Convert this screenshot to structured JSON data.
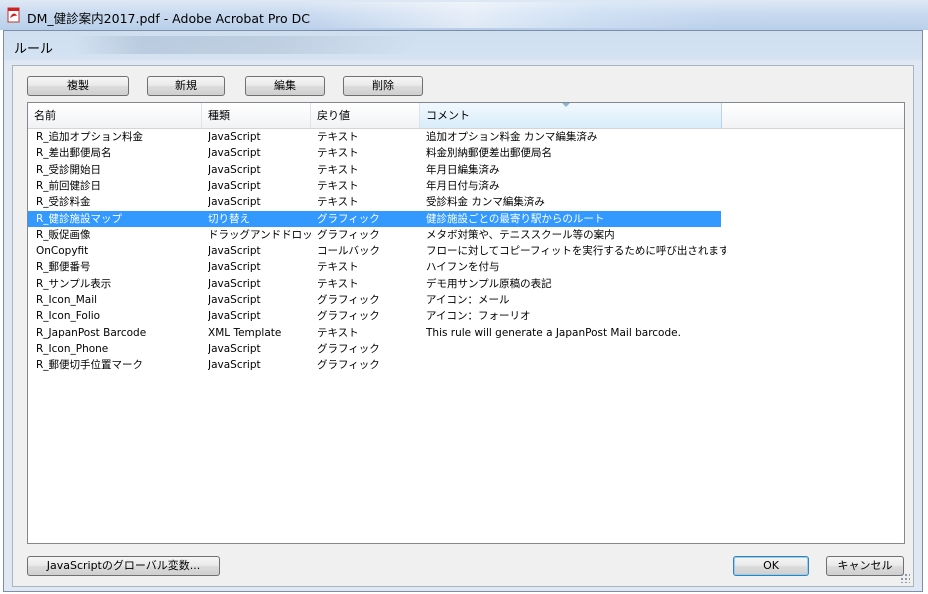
{
  "window": {
    "title": "DM_健診案内2017.pdf - Adobe Acrobat Pro DC",
    "app_icon": "acrobat-pdf-icon"
  },
  "dialog": {
    "title": "ルール"
  },
  "toolbar": {
    "duplicate_label": "複製",
    "new_label": "新規",
    "edit_label": "編集",
    "delete_label": "削除"
  },
  "list": {
    "columns": [
      "名前",
      "種類",
      "戻り値",
      "コメント"
    ],
    "rows": [
      {
        "name": "R_追加オプション料金",
        "type": "JavaScript",
        "ret": "テキスト",
        "comment": "追加オプション料金 カンマ編集済み",
        "selected": false
      },
      {
        "name": "R_差出郵便局名",
        "type": "JavaScript",
        "ret": "テキスト",
        "comment": "料金別納郵便差出郵便局名",
        "selected": false
      },
      {
        "name": "R_受診開始日",
        "type": "JavaScript",
        "ret": "テキスト",
        "comment": "年月日編集済み",
        "selected": false
      },
      {
        "name": "R_前回健診日",
        "type": "JavaScript",
        "ret": "テキスト",
        "comment": "年月日付与済み",
        "selected": false
      },
      {
        "name": "R_受診料金",
        "type": "JavaScript",
        "ret": "テキスト",
        "comment": "受診料金 カンマ編集済み",
        "selected": false
      },
      {
        "name": "R_健診施設マップ",
        "type": "切り替え",
        "ret": "グラフィック",
        "comment": "健診施設ごとの最寄り駅からのルート",
        "selected": true
      },
      {
        "name": "R_販促画像",
        "type": "ドラッグアンドドロップ",
        "ret": "グラフィック",
        "comment": "メタボ対策や、テニススクール等の案内",
        "selected": false
      },
      {
        "name": "OnCopyfit",
        "type": "JavaScript",
        "ret": "コールバック",
        "comment": "フローに対してコピーフィットを実行するために呼び出されます。",
        "selected": false
      },
      {
        "name": "R_郵便番号",
        "type": "JavaScript",
        "ret": "テキスト",
        "comment": "ハイフンを付与",
        "selected": false
      },
      {
        "name": "R_サンプル表示",
        "type": "JavaScript",
        "ret": "テキスト",
        "comment": "デモ用サンプル原稿の表記",
        "selected": false
      },
      {
        "name": "R_Icon_Mail",
        "type": "JavaScript",
        "ret": "グラフィック",
        "comment": "アイコン：メール",
        "selected": false
      },
      {
        "name": "R_Icon_Folio",
        "type": "JavaScript",
        "ret": "グラフィック",
        "comment": "アイコン：フォーリオ",
        "selected": false
      },
      {
        "name": "R_JapanPost Barcode",
        "type": "XML Template",
        "ret": "テキスト",
        "comment": "This rule will generate a JapanPost Mail barcode.",
        "selected": false
      },
      {
        "name": "R_Icon_Phone",
        "type": "JavaScript",
        "ret": "グラフィック",
        "comment": "",
        "selected": false
      },
      {
        "name": "R_郵便切手位置マーク",
        "type": "JavaScript",
        "ret": "グラフィック",
        "comment": "",
        "selected": false
      }
    ]
  },
  "footer": {
    "globals_label": "JavaScriptのグローバル変数...",
    "ok_label": "OK",
    "cancel_label": "キャンセル"
  },
  "colors": {
    "selection": "#3399ff",
    "dialog_bg": "#dfe8f3",
    "panel_bg": "#f0f0f0"
  }
}
